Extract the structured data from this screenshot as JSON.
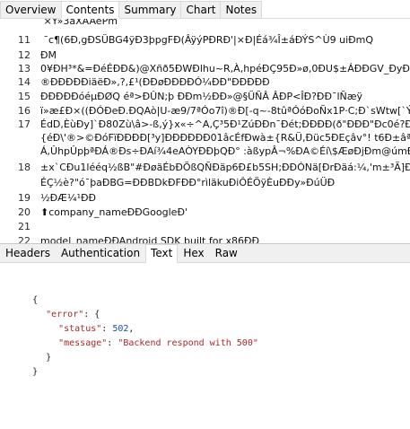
{
  "tabs": {
    "top": [
      "Overview",
      "Contents",
      "Summary",
      "Chart",
      "Notes"
    ],
    "bottom": [
      "Headers",
      "Authentication",
      "Text",
      "Hex",
      "Raw"
    ]
  },
  "code_lines": [
    {
      "num": "",
      "text": " ×Y»3aXÀÀePm"
    },
    {
      "num": "11",
      "text": " ¯c¶(6Ð,gÐSÜBG4ÿÐ3þpgFÐ(ÂÿýPÐRÐ'|×Ð|Éá¾Î±áÐÝS^Ù9                    uiÐmQ"
    },
    {
      "num": "12",
      "text": "ÐM"
    },
    {
      "num": "13",
      "text": "0¥ÐH³*&=ÐéÉÐÐ&)@Xñð5ÐWÐlhu~R,À,hpéÐÇ95Ð»ø,0ÐU$±ÁÐÐGV_ÐyÐ"
    },
    {
      "num": "14",
      "text": "®ÐÐÐÐÐiäëÐ»,?,£¹(ÐÐøÐÐÐÐÓ¼ÐÐ\"ÐÐÐÐÐ"
    },
    {
      "num": "15",
      "text": "ÐÐÐÐÐóéµÐØQ éª>ÐÛN;þ                ÐÐm½ÐÐ»@§ÜÑÂ  ÂÐP<ÎÐ?ÐÐ¯lÑæÿ"
    },
    {
      "num": "16",
      "text": "ï»æ£Ð×((ÐÓÐeÐ.ÐQAò|U-æ9/7ªÓo7î)®Ð[-q~-8tûªÓóÐoÑx1P·C;Ð`sWtw[`Ý\"Ð"
    },
    {
      "num": "17",
      "text": "ÉdD,ÈùÐy]`Ð80Zù\\â>-ß,ý}x«÷^A,Ç³5Ð¹ZúÐÐn¯Ðét;ÐÐÐÐ(ð\"ÐÐÐ\"Ðc0é?ÐVi"
    },
    {
      "num": "",
      "text": "{éÐ\\'®>©ÐóFïÐÐÐÐ[³y]ÐÐÐÐÐÐ01âcÉfÐwà±{R&Ü,Ðüc5ÐEçâv°!  t6Ð±âª!djCÐ"
    },
    {
      "num": "",
      "text": "Á,ÛhpÛpþªÐÁ®Ðs÷ÐAí¾4eAÒYÐÐþQÐ° :àßypÂ¬%ÐA©Éí\\$ÆøÐjÐm@úmÐè"
    },
    {
      "num": "18",
      "text": "±x`CÐu1lééq½ßB\"#ÐøäÉbÐÕßQÑÐäp6Ð£b5SH;ÐÐÓNä[ÐrÐäá:¼,'m±³Ã]ÐÐ¥'8`Ð"
    },
    {
      "num": "",
      "text": "ÉÇ½è?\"ó¯þaÐBG=ÐÐBDkÐFÐÐ°rìläkuÐiÔÉÖÿÈuÐÐy»ÐúÜÐ"
    },
    {
      "num": "19",
      "text": "½ÐÆ¼¹ÐÐ"
    },
    {
      "num": "20",
      "text": "⬆company_nameÐÐGoogleÐ'"
    },
    {
      "num": "21",
      "text": ""
    },
    {
      "num": "22",
      "text": "model_nameÐÐAndroid SDK built for x86ÐÐ"
    }
  ],
  "response": {
    "open_brace": "{",
    "error_key": "\"error\"",
    "status_key": "\"status\"",
    "status_value": "502",
    "message_key": "\"message\"",
    "message_value": "\"Backend respond with 500\"",
    "inner_close": "}",
    "close_brace": "}"
  }
}
